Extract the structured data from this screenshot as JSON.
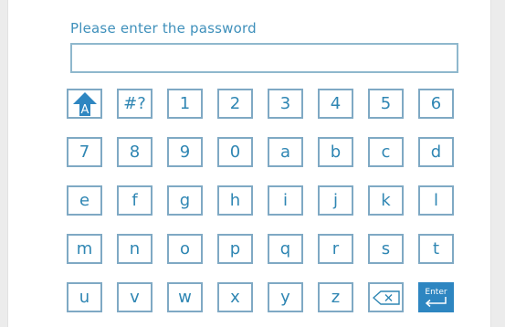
{
  "prompt_label": "Please enter the password",
  "password_value": "",
  "keyboard": {
    "rows": [
      [
        {
          "label": "",
          "name": "shift-key",
          "icon": "shift-arrow-A-icon",
          "icon_text": "A"
        },
        {
          "label": "#?",
          "name": "symbols-key"
        },
        {
          "label": "1",
          "name": "key-1"
        },
        {
          "label": "2",
          "name": "key-2"
        },
        {
          "label": "3",
          "name": "key-3"
        },
        {
          "label": "4",
          "name": "key-4"
        },
        {
          "label": "5",
          "name": "key-5"
        },
        {
          "label": "6",
          "name": "key-6"
        }
      ],
      [
        {
          "label": "7",
          "name": "key-7"
        },
        {
          "label": "8",
          "name": "key-8"
        },
        {
          "label": "9",
          "name": "key-9"
        },
        {
          "label": "0",
          "name": "key-0"
        },
        {
          "label": "a",
          "name": "key-a"
        },
        {
          "label": "b",
          "name": "key-b"
        },
        {
          "label": "c",
          "name": "key-c"
        },
        {
          "label": "d",
          "name": "key-d"
        }
      ],
      [
        {
          "label": "e",
          "name": "key-e"
        },
        {
          "label": "f",
          "name": "key-f"
        },
        {
          "label": "g",
          "name": "key-g"
        },
        {
          "label": "h",
          "name": "key-h"
        },
        {
          "label": "i",
          "name": "key-i"
        },
        {
          "label": "j",
          "name": "key-j"
        },
        {
          "label": "k",
          "name": "key-k"
        },
        {
          "label": "l",
          "name": "key-l"
        }
      ],
      [
        {
          "label": "m",
          "name": "key-m"
        },
        {
          "label": "n",
          "name": "key-n"
        },
        {
          "label": "o",
          "name": "key-o"
        },
        {
          "label": "p",
          "name": "key-p"
        },
        {
          "label": "q",
          "name": "key-q"
        },
        {
          "label": "r",
          "name": "key-r"
        },
        {
          "label": "s",
          "name": "key-s"
        },
        {
          "label": "t",
          "name": "key-t"
        }
      ],
      [
        {
          "label": "u",
          "name": "key-u"
        },
        {
          "label": "v",
          "name": "key-v"
        },
        {
          "label": "w",
          "name": "key-w"
        },
        {
          "label": "x",
          "name": "key-x"
        },
        {
          "label": "y",
          "name": "key-y"
        },
        {
          "label": "z",
          "name": "key-z"
        },
        {
          "label": "",
          "name": "backspace-key",
          "icon": "backspace-icon"
        },
        {
          "label": "",
          "name": "enter-key",
          "icon": "enter-icon",
          "icon_text": "Enter"
        }
      ]
    ]
  },
  "colors": {
    "accent": "#3f90bb",
    "key_border": "#7fa9c4",
    "key_text": "#2f86b3",
    "highlight_fill": "#2e86c1"
  }
}
